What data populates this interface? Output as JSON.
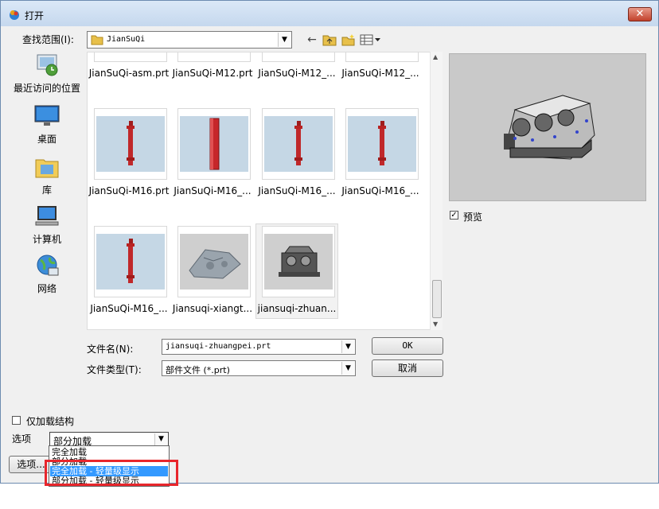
{
  "window": {
    "title": "打开",
    "close_label": "✕"
  },
  "toolbar": {
    "look_in_label": "查找范围(I):",
    "look_in_value": "JianSuQi",
    "icons": [
      "back-arrow-icon",
      "up-folder-icon",
      "new-folder-icon",
      "view-menu-icon"
    ]
  },
  "places": [
    {
      "label": "最近访问的位置",
      "icon": "recent-places-icon"
    },
    {
      "label": "桌面",
      "icon": "desktop-icon"
    },
    {
      "label": "库",
      "icon": "libraries-icon"
    },
    {
      "label": "计算机",
      "icon": "computer-icon"
    },
    {
      "label": "网络",
      "icon": "network-icon"
    }
  ],
  "files": [
    {
      "name": "JianSuQi-asm.prt"
    },
    {
      "name": "JianSuQi-M12.prt"
    },
    {
      "name": "JianSuQi-M12_..."
    },
    {
      "name": "JianSuQi-M12_..."
    },
    {
      "name": "JianSuQi-M16.prt",
      "thumb": "red-bolt"
    },
    {
      "name": "JianSuQi-M16_...",
      "thumb": "red-bar"
    },
    {
      "name": "JianSuQi-M16_...",
      "thumb": "red-bolt"
    },
    {
      "name": "JianSuQi-M16_...",
      "thumb": "red-bolt"
    },
    {
      "name": "JianSuQi-M16_...",
      "thumb": "red-bolt"
    },
    {
      "name": "Jiansuqi-xiangt...",
      "thumb": "housing"
    },
    {
      "name": "jiansuqi-zhuan...",
      "thumb": "gearbox",
      "selected": true
    }
  ],
  "preview": {
    "checkbox_label": "预览",
    "checked": true
  },
  "filename": {
    "label": "文件名(N):",
    "value": "jiansuqi-zhuangpei.prt"
  },
  "filetype": {
    "label": "文件类型(T):",
    "value": "部件文件 (*.prt)"
  },
  "buttons": {
    "ok": "OK",
    "cancel": "取消",
    "options": "选项..."
  },
  "options": {
    "structure_only_label": "仅加载结构",
    "structure_only_checked": false,
    "options_label": "选项",
    "load_value": "部分加载",
    "dropdown_items": [
      "完全加载",
      "部分加载",
      "完全加载 - 轻量级显示",
      "部分加载 - 轻量级显示"
    ],
    "highlighted_index": 2
  },
  "colors": {
    "highlight": "#3399ff",
    "annotation": "#e8262c",
    "thumb_bg": "#c5d7e5"
  }
}
